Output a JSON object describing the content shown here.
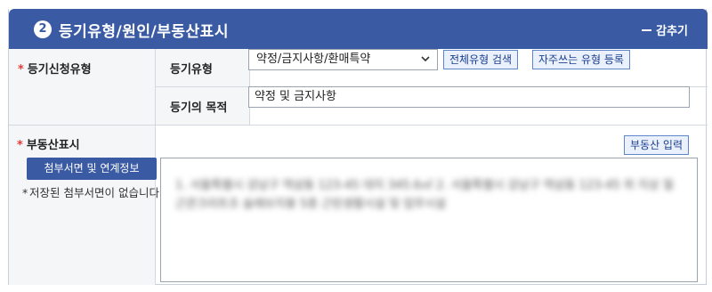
{
  "header": {
    "step_number": "2",
    "title": "등기유형/원인/부동산표시",
    "collapse_label": "감추기"
  },
  "registration": {
    "section_label": "등기신청유형",
    "type_label": "등기유형",
    "type_value": "약정/금지사항/환매특약",
    "search_all_button": "전체유형 검색",
    "register_frequent_button": "자주쓰는 유형 등록",
    "purpose_label": "등기의 목적",
    "purpose_value": "약정 및 금지사항"
  },
  "property": {
    "section_label": "부동산표시",
    "attach_button": "첨부서면 및 연계정보",
    "note": "저장된 첨부서면이 없습니다.",
    "input_button": "부동산 입력",
    "blurred_text": "1. 서울특별시 강남구 역삼동 123-45 대지 345.6㎡ 2. 서울특별시 강남구 역삼동 123-45 위 지상 철근콘크리트조 슬래브지붕 5층 근린생활시설 및 업무시설"
  },
  "colors": {
    "header_bg": "#3a5ba3",
    "required_mark": "#e53b3b",
    "label_bg": "#f5f6f8"
  }
}
